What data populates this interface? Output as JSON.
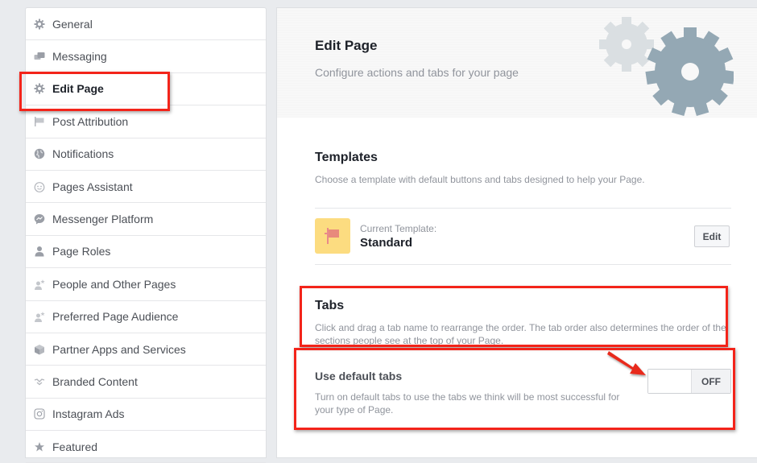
{
  "sidebar": {
    "items": [
      {
        "label": "General",
        "icon": "gear-icon"
      },
      {
        "label": "Messaging",
        "icon": "chat-bubbles-icon"
      },
      {
        "label": "Edit Page",
        "icon": "gear-icon",
        "active": true
      },
      {
        "label": "Post Attribution",
        "icon": "flag-icon"
      },
      {
        "label": "Notifications",
        "icon": "globe-icon"
      },
      {
        "label": "Pages Assistant",
        "icon": "smiley-icon"
      },
      {
        "label": "Messenger Platform",
        "icon": "messenger-icon"
      },
      {
        "label": "Page Roles",
        "icon": "person-icon"
      },
      {
        "label": "People and Other Pages",
        "icon": "person-star-icon"
      },
      {
        "label": "Preferred Page Audience",
        "icon": "person-star-icon"
      },
      {
        "label": "Partner Apps and Services",
        "icon": "cube-icon"
      },
      {
        "label": "Branded Content",
        "icon": "handshake-icon"
      },
      {
        "label": "Instagram Ads",
        "icon": "instagram-icon"
      },
      {
        "label": "Featured",
        "icon": "star-icon"
      }
    ]
  },
  "header": {
    "title": "Edit Page",
    "subtitle": "Configure actions and tabs for your page"
  },
  "templates": {
    "title": "Templates",
    "description": "Choose a template with default buttons and tabs designed to help your Page.",
    "current_label": "Current Template:",
    "current_name": "Standard",
    "edit_label": "Edit"
  },
  "tabs": {
    "title": "Tabs",
    "description": "Click and drag a tab name to rearrange the order. The tab order also determines the order of the sections people see at the top of your Page."
  },
  "default_tabs": {
    "title": "Use default tabs",
    "description": "Turn on default tabs to use the tabs we think will be most successful for your type of Page.",
    "toggle_state": "OFF"
  },
  "colors": {
    "annotation": "#f3241a",
    "gear_light": "#dadfe2",
    "gear_dark": "#94a8b4",
    "template_bg": "#fcdc80"
  }
}
